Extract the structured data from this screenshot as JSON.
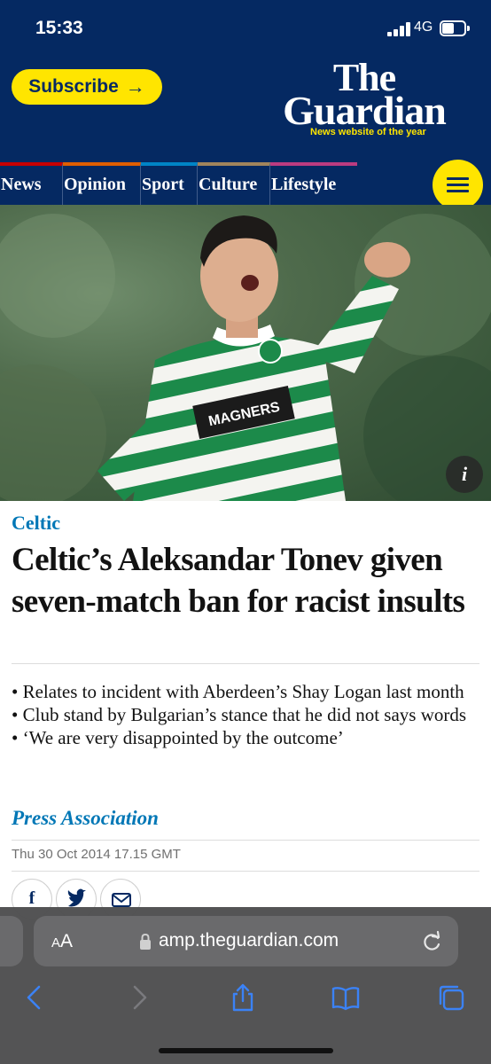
{
  "status_bar": {
    "time": "15:33",
    "network": "4G"
  },
  "masthead": {
    "subscribe_label": "Subscribe",
    "subscribe_arrow": "→",
    "logo_line1": "The",
    "logo_line2": "Guardian",
    "tagline": "News website of the year"
  },
  "nav": {
    "items": [
      {
        "label": "News",
        "color": "#c70000"
      },
      {
        "label": "Opinion",
        "color": "#e05e00"
      },
      {
        "label": "Sport",
        "color": "#0084c6"
      },
      {
        "label": "Culture",
        "color": "#a1845c"
      },
      {
        "label": "Lifestyle",
        "color": "#bb3b80"
      }
    ],
    "menu_icon": "hamburger-icon"
  },
  "hero": {
    "sponsor_text": "MAGNERS",
    "info_label": "i"
  },
  "article": {
    "kicker": "Celtic",
    "headline": "Celtic’s Aleksandar Tonev given seven-match ban for racist insults",
    "standfirst": [
      "• Relates to incident with Aberdeen’s Shay Logan last month",
      "• Club stand by Bulgarian’s stance that he did not says words",
      "• ‘We are very disappointed by the outcome’"
    ],
    "byline": "Press Association",
    "dateline": "Thu 30 Oct 2014 17.15 GMT",
    "share": {
      "facebook": "f",
      "twitter": "twitter-icon",
      "email": "mail-icon"
    }
  },
  "browser": {
    "text_size_small": "A",
    "text_size_big": "A",
    "url": "amp.theguardian.com",
    "toolbar": [
      "back-icon",
      "forward-icon",
      "share-icon",
      "bookmarks-icon",
      "tabs-icon"
    ]
  },
  "colors": {
    "brand_blue": "#052962",
    "brand_yellow": "#ffe500",
    "link_blue": "#0077b6"
  }
}
